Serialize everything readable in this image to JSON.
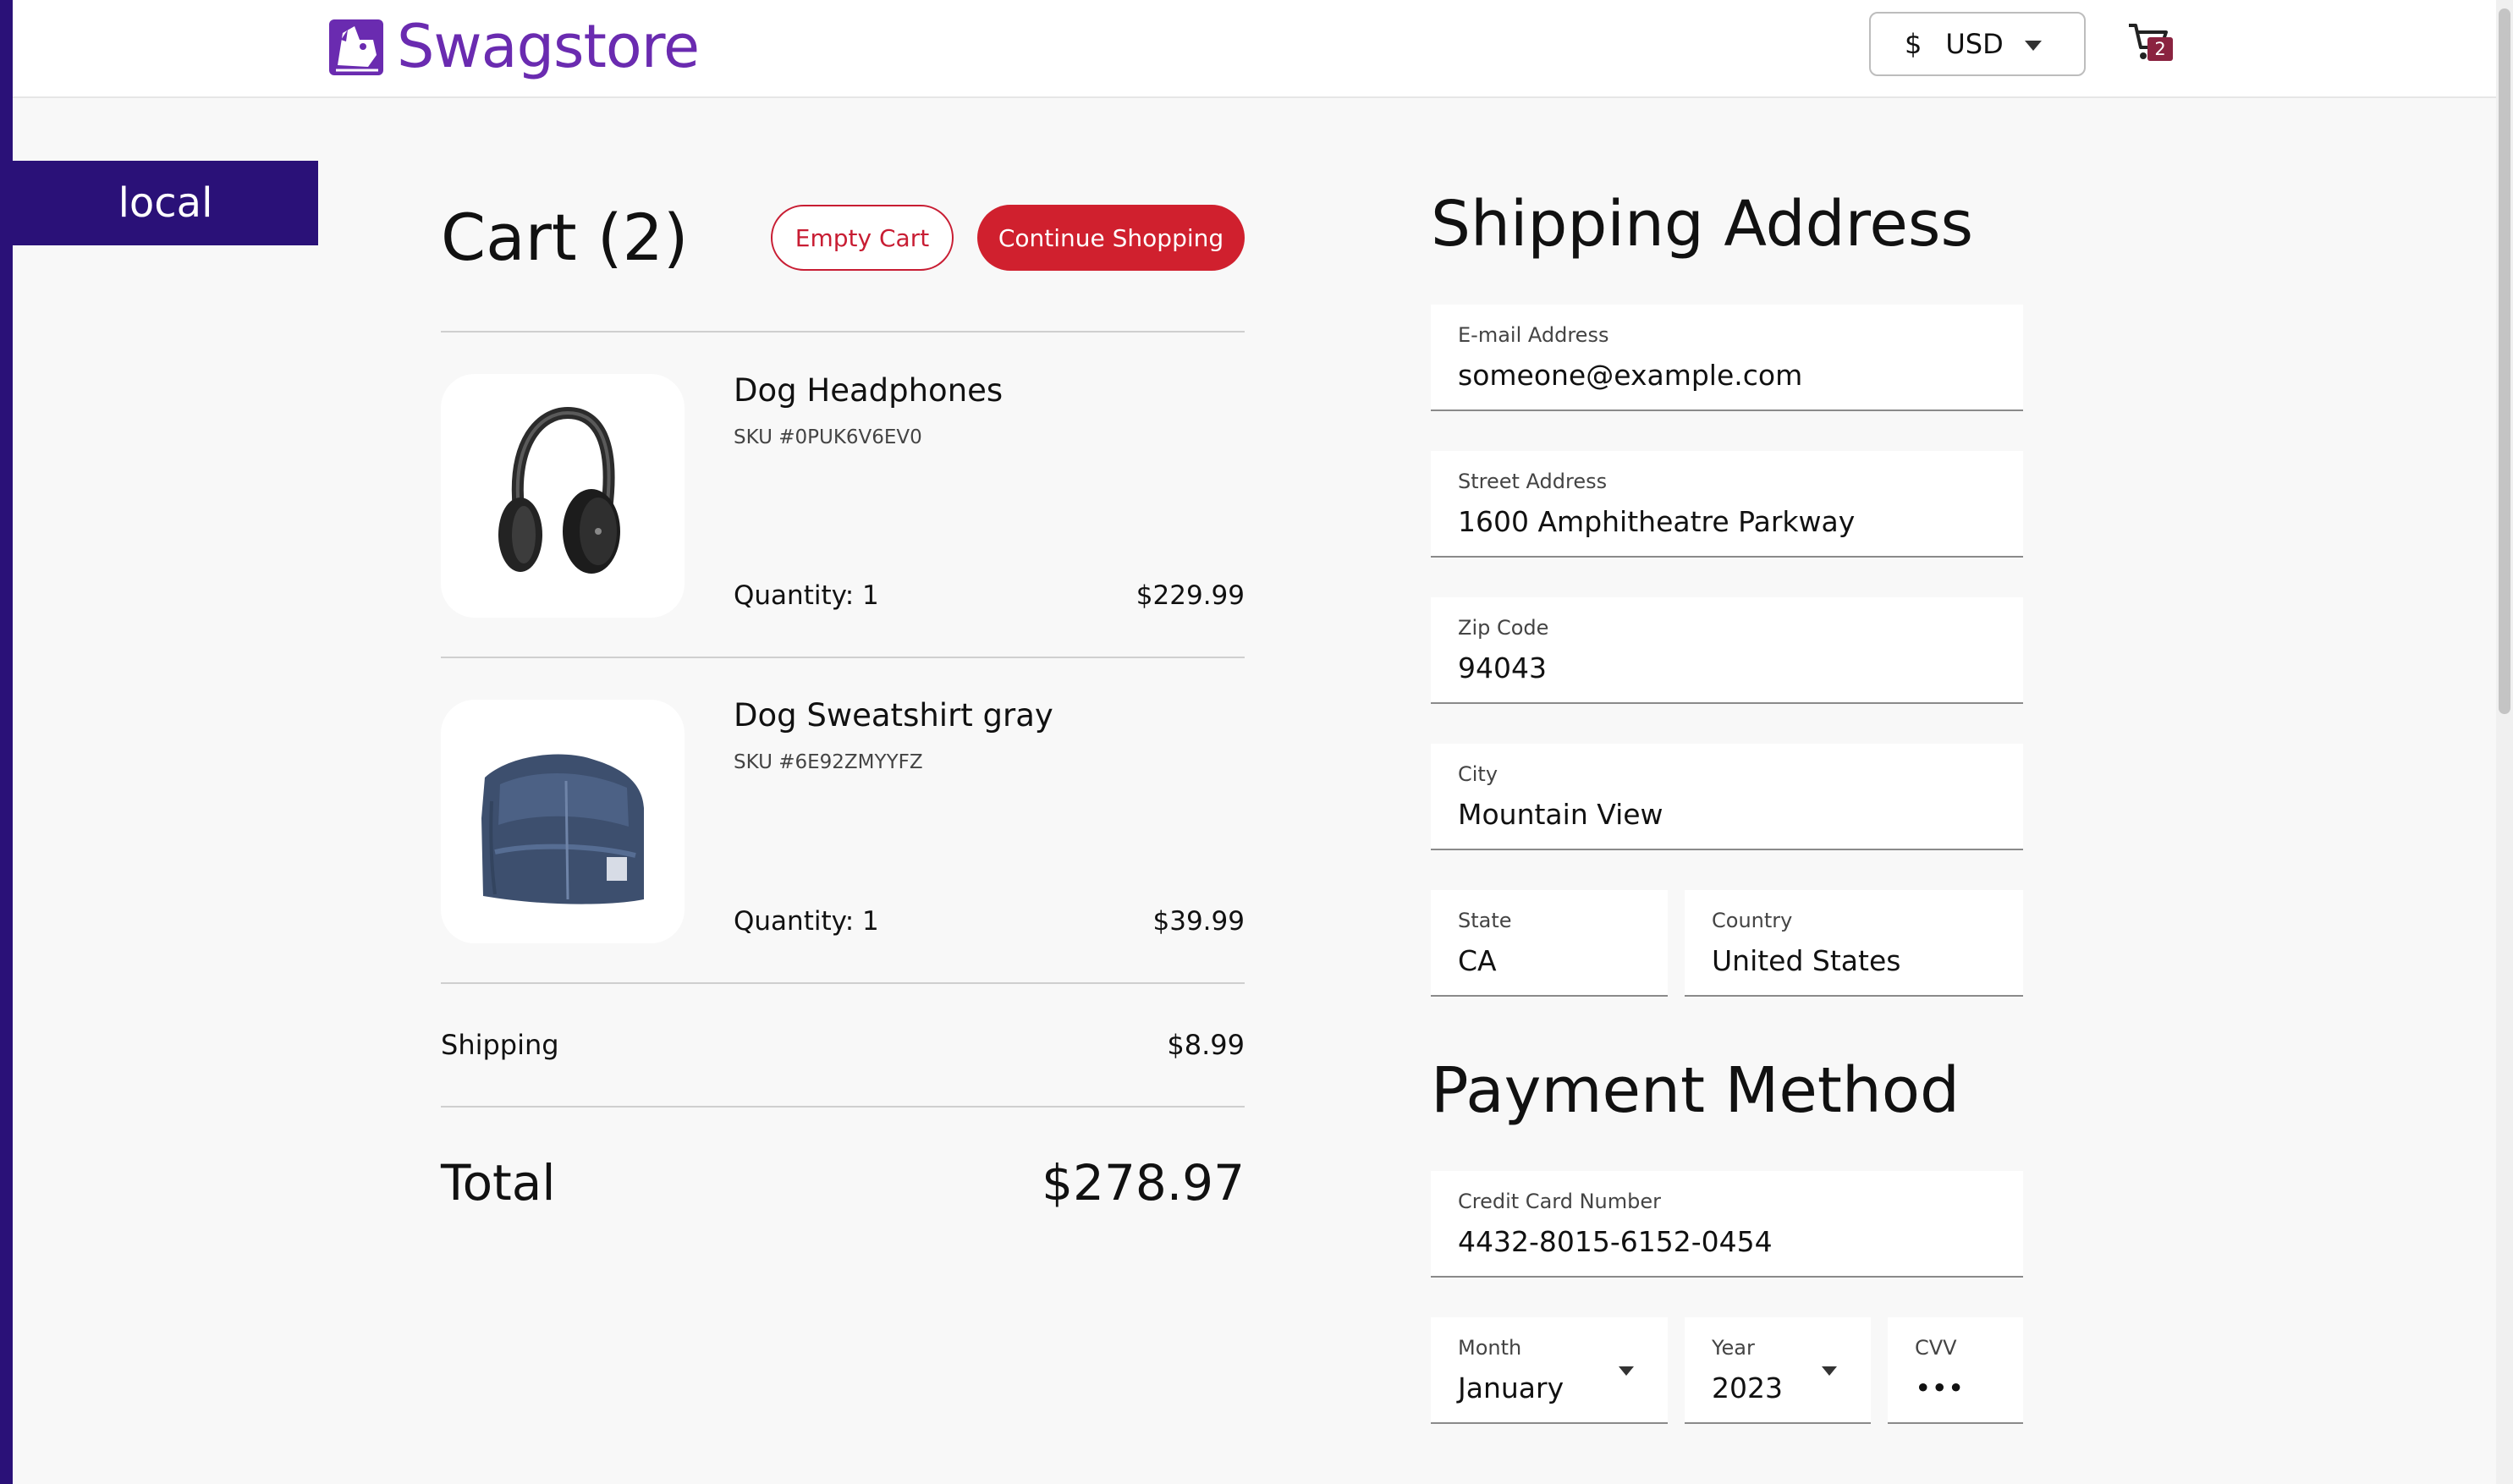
{
  "brand": {
    "name": "Swagstore",
    "accent": "#6a2bb0"
  },
  "header": {
    "currency_symbol": "$",
    "currency_code": "USD",
    "cart_count": "2"
  },
  "environment_label": "local",
  "cart": {
    "title": "Cart (2)",
    "empty_label": "Empty Cart",
    "continue_label": "Continue Shopping",
    "items": [
      {
        "name": "Dog Headphones",
        "sku": "SKU #0PUK6V6EV0",
        "quantity": "Quantity: 1",
        "price": "$229.99",
        "icon": "headphones"
      },
      {
        "name": "Dog Sweatshirt gray",
        "sku": "SKU #6E92ZMYYFZ",
        "quantity": "Quantity: 1",
        "price": "$39.99",
        "icon": "sweatshirt"
      }
    ],
    "shipping_label": "Shipping",
    "shipping_value": "$8.99",
    "total_label": "Total",
    "total_value": "$278.97"
  },
  "shipping_address": {
    "title": "Shipping Address",
    "email": {
      "label": "E-mail Address",
      "value": "someone@example.com"
    },
    "street": {
      "label": "Street Address",
      "value": "1600 Amphitheatre Parkway"
    },
    "zip": {
      "label": "Zip Code",
      "value": "94043"
    },
    "city": {
      "label": "City",
      "value": "Mountain View"
    },
    "state": {
      "label": "State",
      "value": "CA"
    },
    "country": {
      "label": "Country",
      "value": "United States"
    }
  },
  "payment": {
    "title": "Payment Method",
    "card": {
      "label": "Credit Card Number",
      "value": "4432-8015-6152-0454"
    },
    "month": {
      "label": "Month",
      "value": "January"
    },
    "year": {
      "label": "Year",
      "value": "2023"
    },
    "cvv": {
      "label": "CVV",
      "value": "•••"
    }
  },
  "colors": {
    "primary_red": "#d0202e",
    "env_badge": "#2a1178",
    "cart_badge": "#8a2340"
  }
}
